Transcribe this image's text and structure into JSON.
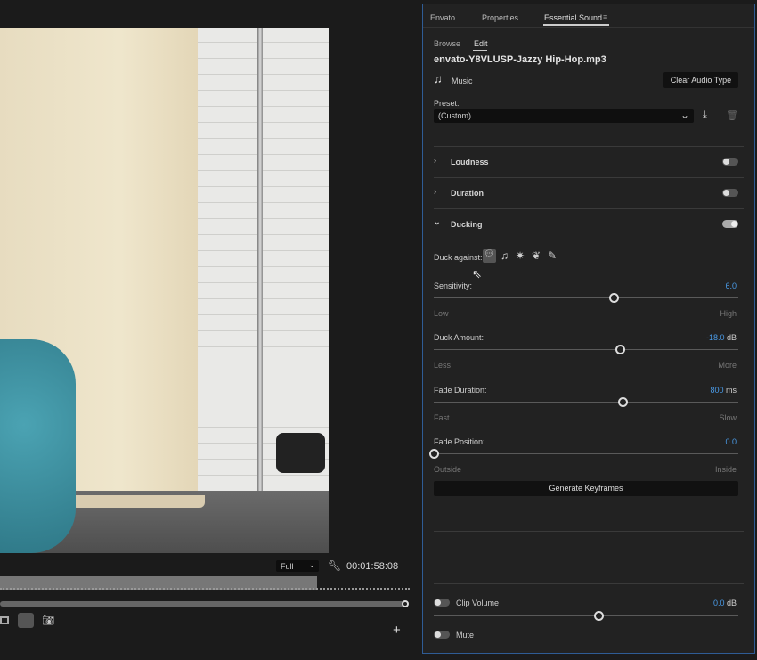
{
  "tabs": [
    {
      "label": "Envato"
    },
    {
      "label": "Properties"
    },
    {
      "label": "Essential Sound",
      "active": true
    }
  ],
  "subtabs": [
    {
      "label": "Browse"
    },
    {
      "label": "Edit",
      "active": true
    }
  ],
  "file_name": "envato-Y8VLUSP-Jazzy Hip-Hop.mp3",
  "audio_type": "Music",
  "clear_audio_type": "Clear Audio Type",
  "preset_label": "Preset:",
  "preset_value": "(Custom)",
  "sections": [
    {
      "label": "Loudness",
      "enabled": false,
      "expanded": false
    },
    {
      "label": "Duration",
      "enabled": false,
      "expanded": false
    },
    {
      "label": "Ducking",
      "enabled": true,
      "expanded": true
    }
  ],
  "duck_against_label": "Duck against:",
  "duck_icons": [
    "dialogue-icon",
    "music-icon",
    "sfx-icon",
    "ambience-icon",
    "unassigned-icon"
  ],
  "sliders": [
    {
      "label": "Sensitivity:",
      "value": "6.0",
      "unit": "",
      "min": "Low",
      "max": "High",
      "fraction": 0.59
    },
    {
      "label": "Duck Amount:",
      "value": "-18.0",
      "unit": "dB",
      "min": "Less",
      "max": "More",
      "fraction": 0.61
    },
    {
      "label": "Fade Duration:",
      "value": "800",
      "unit": "ms",
      "min": "Fast",
      "max": "Slow",
      "fraction": 0.62
    },
    {
      "label": "Fade Position:",
      "value": "0.0",
      "unit": "",
      "min": "Outside",
      "max": "Inside",
      "fraction": 0.0
    }
  ],
  "generate_keyframes": "Generate Keyframes",
  "clip_volume": {
    "label": "Clip Volume",
    "value": "0.0",
    "unit": "dB",
    "enabled": false,
    "fraction": 0.54
  },
  "mute": {
    "label": "Mute",
    "enabled": false
  },
  "monitor": {
    "resolution": "Full",
    "timecode": "00:01:58:08",
    "playhead_fraction": 0.97
  },
  "accent": "#4a9be8"
}
